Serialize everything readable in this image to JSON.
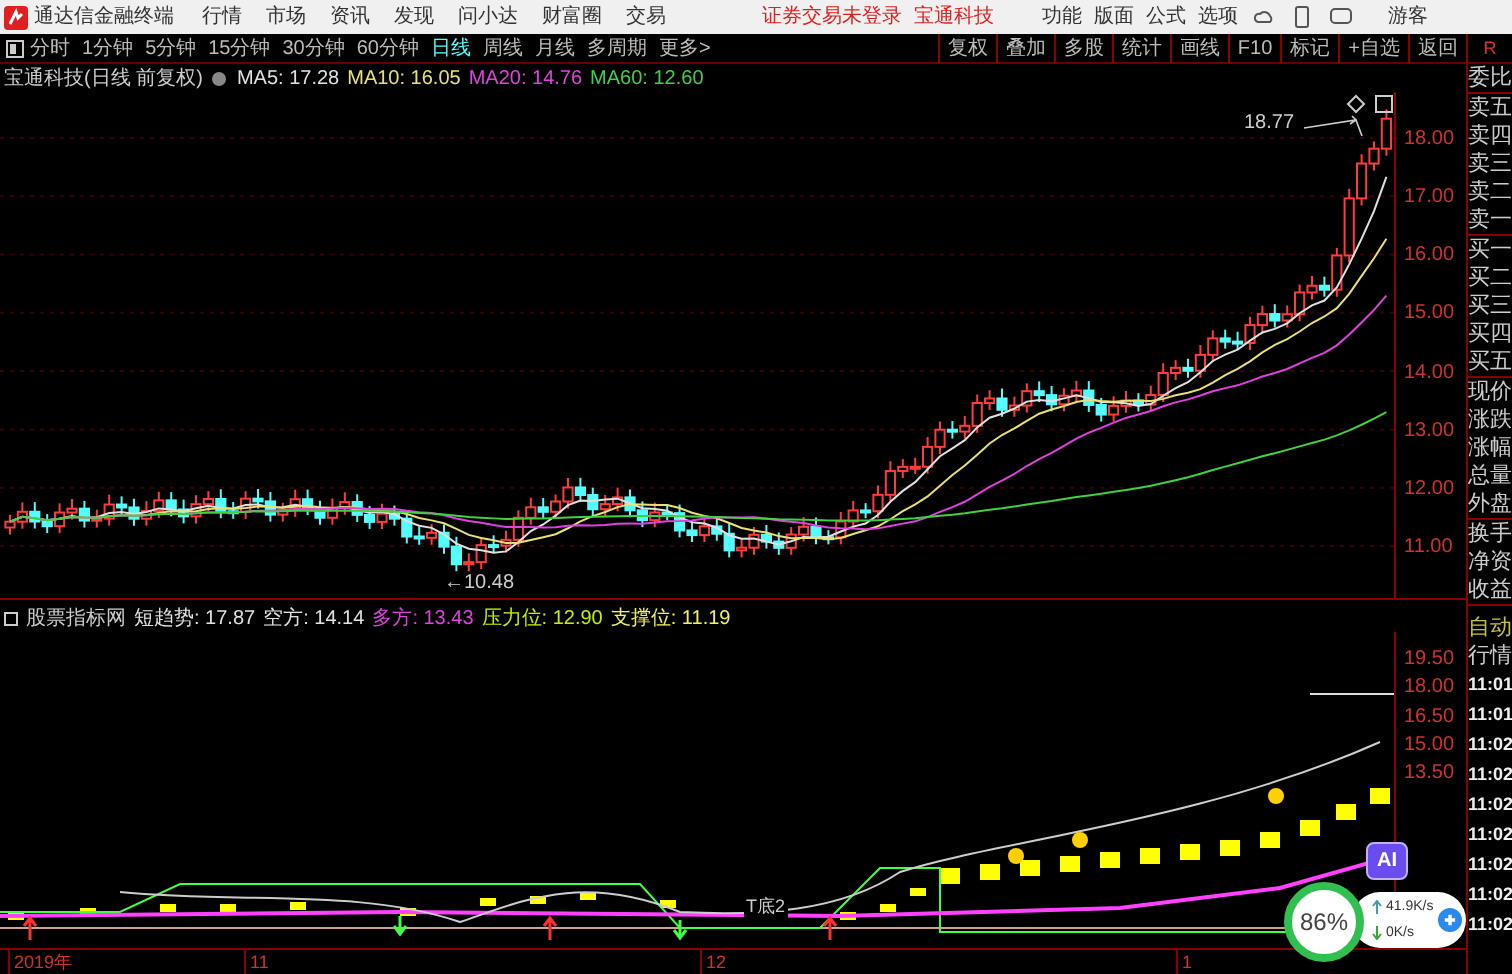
{
  "app": {
    "title": "通达信金融终端",
    "menu": [
      "行情",
      "市场",
      "资讯",
      "发现",
      "问小达",
      "财富圈",
      "交易"
    ],
    "login_status": "证券交易未登录",
    "stock_link": "宝通科技",
    "tools": [
      "功能",
      "版面",
      "公式",
      "选项"
    ],
    "user": "游客"
  },
  "periods": [
    {
      "label": "分时",
      "selected": false
    },
    {
      "label": "1分钟",
      "selected": false
    },
    {
      "label": "5分钟",
      "selected": false
    },
    {
      "label": "15分钟",
      "selected": false
    },
    {
      "label": "30分钟",
      "selected": false
    },
    {
      "label": "60分钟",
      "selected": false
    },
    {
      "label": "日线",
      "selected": true
    },
    {
      "label": "周线",
      "selected": false
    },
    {
      "label": "月线",
      "selected": false
    },
    {
      "label": "多周期",
      "selected": false
    },
    {
      "label": "更多>",
      "selected": false
    }
  ],
  "toolbar": [
    "复权",
    "叠加",
    "多股",
    "统计",
    "画线",
    "F10",
    "标记",
    "+自选",
    "返回"
  ],
  "main_chart": {
    "title": "宝通科技(日线 前复权)",
    "ma": [
      {
        "label": "MA5: 17.28",
        "color": "#e0e0e0"
      },
      {
        "label": "MA10: 16.05",
        "color": "#e8e070"
      },
      {
        "label": "MA20: 14.76",
        "color": "#e040e0"
      },
      {
        "label": "MA60: 12.60",
        "color": "#40d040"
      }
    ],
    "price_axis": [
      "18.00",
      "17.00",
      "16.00",
      "15.00",
      "14.00",
      "13.00",
      "12.00",
      "11.00"
    ],
    "high_label": "18.77",
    "low_label": "←10.48"
  },
  "indicator": {
    "title": "股票指标网",
    "values": [
      {
        "label": "短趋势: 17.87",
        "color": "#e0e0e0"
      },
      {
        "label": "空方: 14.14",
        "color": "#e0e0e0"
      },
      {
        "label": "多方: 13.43",
        "color": "#e040e0"
      },
      {
        "label": "压力位: 12.90",
        "color": "#c0f000"
      },
      {
        "label": "支撑位: 11.19",
        "color": "#f0f060"
      }
    ],
    "axis": [
      "19.50",
      "18.00",
      "16.50",
      "15.00",
      "13.50"
    ],
    "mark": "T底2"
  },
  "date_axis": [
    "2019年",
    "11",
    "12",
    "1"
  ],
  "side_panel": {
    "badge": "R",
    "quote_labels": [
      "委比",
      "卖五",
      "卖四",
      "卖三",
      "卖二",
      "卖一",
      "买一",
      "买二",
      "买三",
      "买四",
      "买五",
      "现价",
      "涨跌",
      "涨幅",
      "总量",
      "外盘",
      "换手",
      "净资",
      "收益"
    ],
    "tabs": [
      {
        "label": "自动",
        "selected": true
      },
      {
        "label": "行情",
        "selected": false
      }
    ],
    "times": [
      "11:01",
      "11:01",
      "11:02",
      "11:02",
      "11:02",
      "11:02",
      "11:02",
      "11:02",
      "11:02"
    ]
  },
  "overlay": {
    "ai": "AI",
    "usage": "86%",
    "upload": "41.9K/s",
    "download": "0K/s"
  }
}
